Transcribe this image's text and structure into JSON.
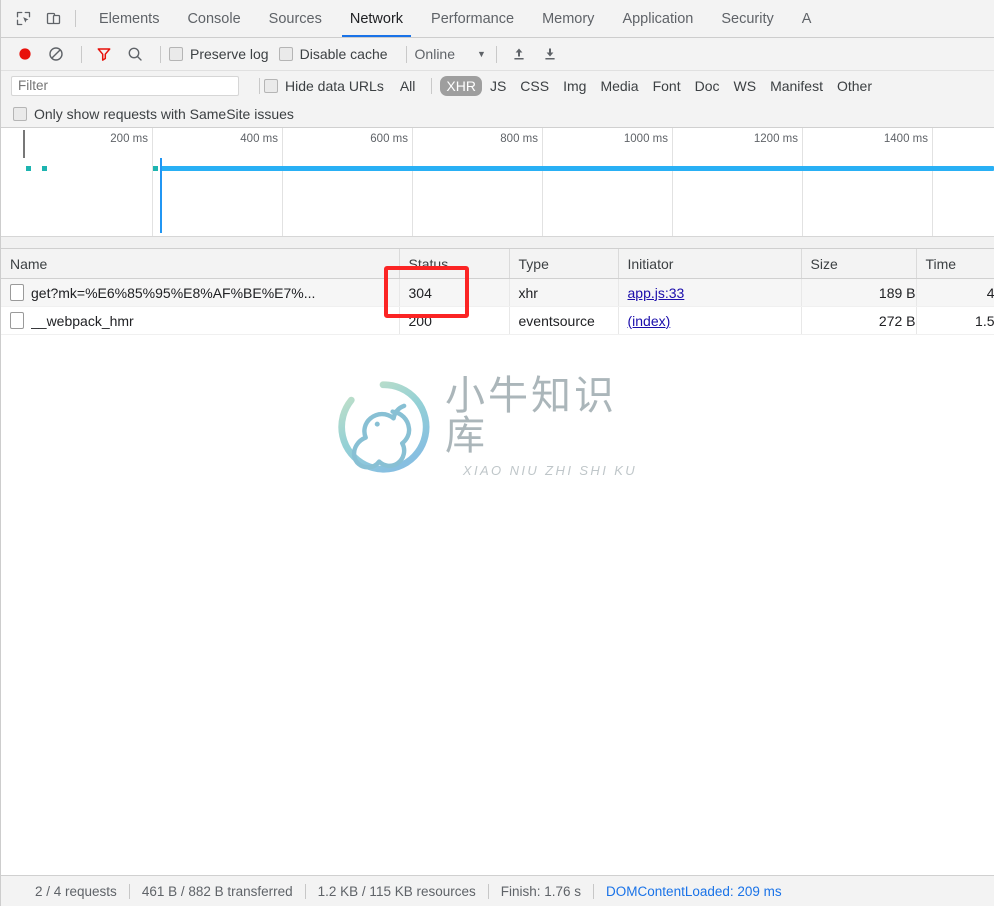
{
  "window": {
    "left_icons": [
      {
        "name": "inspect-element-icon",
        "glyph": "inspect"
      },
      {
        "name": "device-toolbar-icon",
        "glyph": "device"
      }
    ]
  },
  "tabs": [
    {
      "label": "Elements",
      "selected": false
    },
    {
      "label": "Console",
      "selected": false
    },
    {
      "label": "Sources",
      "selected": false
    },
    {
      "label": "Network",
      "selected": true
    },
    {
      "label": "Performance",
      "selected": false
    },
    {
      "label": "Memory",
      "selected": false
    },
    {
      "label": "Application",
      "selected": false
    },
    {
      "label": "Security",
      "selected": false
    },
    {
      "label": "A",
      "selected": false
    }
  ],
  "network_toolbar": {
    "record_label": "record-button",
    "clear_label": "clear-button",
    "filter_label": "filter-button",
    "search_label": "search-button",
    "preserve_log": "Preserve log",
    "disable_cache": "Disable cache",
    "throttle_value": "Online",
    "caret": "▼",
    "import_har": "import-har-button",
    "export_har": "export-har-button"
  },
  "filter_bar": {
    "filter_placeholder": "Filter",
    "filter_value": "",
    "hide_data_urls": "Hide data URLs",
    "types": [
      {
        "label": "All",
        "active": false
      },
      {
        "label": "XHR",
        "active": true
      },
      {
        "label": "JS",
        "active": false
      },
      {
        "label": "CSS",
        "active": false
      },
      {
        "label": "Img",
        "active": false
      },
      {
        "label": "Media",
        "active": false
      },
      {
        "label": "Font",
        "active": false
      },
      {
        "label": "Doc",
        "active": false
      },
      {
        "label": "WS",
        "active": false
      },
      {
        "label": "Manifest",
        "active": false
      },
      {
        "label": "Other",
        "active": false
      }
    ],
    "samesite_label": "Only show requests with SameSite issues"
  },
  "overview": {
    "tick_labels": [
      "200 ms",
      "400 ms",
      "600 ms",
      "800 ms",
      "1000 ms",
      "1200 ms",
      "1400 ms"
    ],
    "dcl_marker_ms": 209,
    "bar_color": "#29b0f5",
    "dcl_color": "#2196f3",
    "dot_color": "#1db4b0"
  },
  "table": {
    "columns": [
      "Name",
      "Status",
      "Type",
      "Initiator",
      "Size",
      "Time"
    ],
    "rows": [
      {
        "name": "get?mk=%E6%85%95%E8%AF%BE%E7%...",
        "status": "304",
        "type": "xhr",
        "initiator": "app.js:33",
        "size": "189 B",
        "time": "4"
      },
      {
        "name": "__webpack_hmr",
        "status": "200",
        "type": "eventsource",
        "initiator": "(index)",
        "size": "272 B",
        "time": "1.5"
      }
    ]
  },
  "annotation": {
    "shape": "rectangle",
    "color": "#fb2424",
    "target": "status-cell-304"
  },
  "watermark": {
    "title": "小牛知识库",
    "pinyin": "XIAO NIU ZHI SHI KU"
  },
  "status_bar": {
    "requests": "2 / 4 requests",
    "transferred": "461 B / 882 B transferred",
    "resources": "1.2 KB / 115 KB resources",
    "finish": "Finish: 1.76 s",
    "dom_content_loaded": "DOMContentLoaded: 209 ms"
  }
}
